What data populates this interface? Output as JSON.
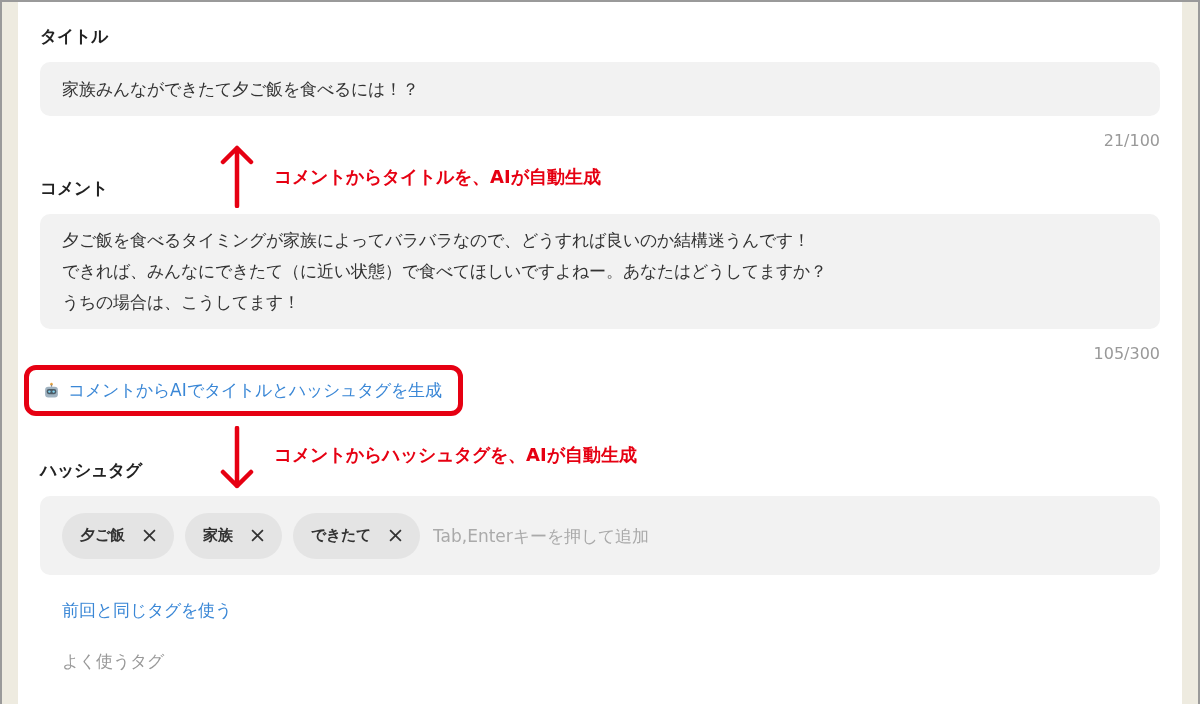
{
  "title_field": {
    "label": "タイトル",
    "value": "家族みんなができたて夕ご飯を食べるには！？",
    "counter": "21/100"
  },
  "comment_field": {
    "label": "コメント",
    "lines": [
      "夕ご飯を食べるタイミングが家族によってバラバラなので、どうすれば良いのか結構迷うんです！",
      "できれば、みんなにできたて（に近い状態）で食べてほしいですよねー。あなたはどうしてますか？",
      "うちの場合は、こうしてます！"
    ],
    "counter": "105/300"
  },
  "ai_generate_link": {
    "label": "コメントからAIでタイトルとハッシュタグを生成",
    "highlighted": true
  },
  "hashtags": {
    "label": "ハッシュタグ",
    "tags": [
      "夕ご飯",
      "家族",
      "できたて"
    ],
    "placeholder": "Tab,Enterキーを押して追加"
  },
  "reuse_tags_link": "前回と同じタグを使う",
  "frequent_tags_label": "よく使うタグ",
  "annotations": [
    {
      "kind": "up",
      "text": "コメントからタイトルを、AIが自動生成"
    },
    {
      "kind": "down",
      "text": "コメントからハッシュタグを、AIが自動生成"
    }
  ]
}
